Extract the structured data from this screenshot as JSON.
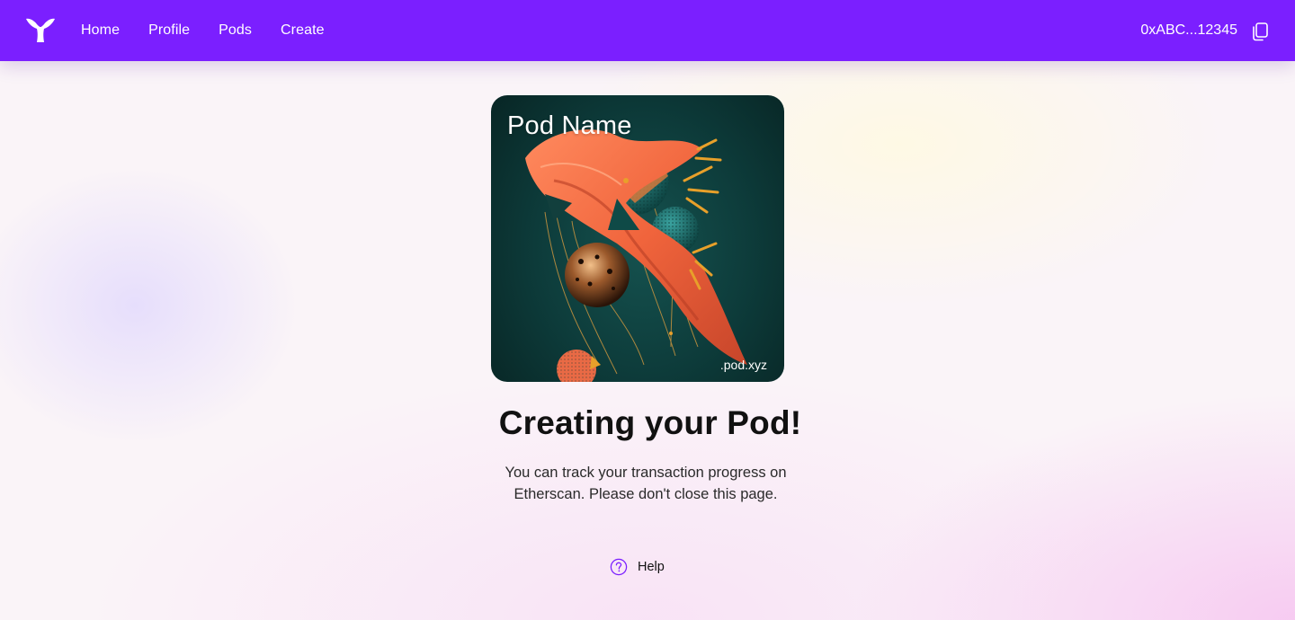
{
  "navbar": {
    "logo_icon": "whale-tail-icon",
    "links": [
      {
        "label": "Home"
      },
      {
        "label": "Profile"
      },
      {
        "label": "Pods"
      },
      {
        "label": "Create"
      }
    ],
    "wallet_address": "0xABC...12345",
    "copy_icon": "copy-icon",
    "background": "#7b1fff"
  },
  "card": {
    "pod_name": "Pod Name",
    "domain": ".pod.xyz"
  },
  "main": {
    "title": "Creating your Pod!",
    "description": "You can track your transaction progress on Etherscan. Please don't close this page."
  },
  "help": {
    "label": "Help",
    "icon": "question-circle-icon",
    "icon_color": "#7b1fff"
  }
}
